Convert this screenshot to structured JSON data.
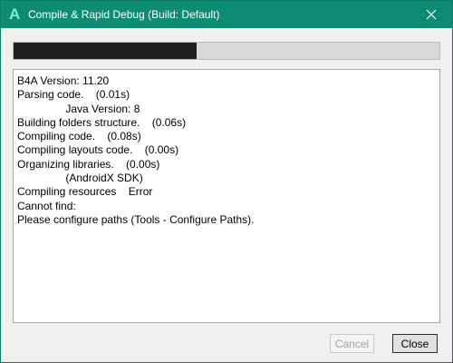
{
  "window": {
    "title": "Compile & Rapid Debug (Build: Default)",
    "icon_letter": "A",
    "colors": {
      "titlebar": "#0e8c73",
      "progress_fill": "#1f1f1f"
    }
  },
  "progress": {
    "fraction": 0.43
  },
  "log": {
    "lines": [
      "B4A Version: 11.20",
      "Parsing code.    (0.01s)",
      "                Java Version: 8",
      "Building folders structure.    (0.06s)",
      "Compiling code.    (0.08s)",
      "Compiling layouts code.    (0.00s)",
      "Organizing libraries.    (0.00s)",
      "                (AndroidX SDK)",
      "Compiling resources    Error",
      "Cannot find:",
      "Please configure paths (Tools - Configure Paths)."
    ]
  },
  "buttons": {
    "cancel_label": "Cancel",
    "close_label": "Close"
  }
}
